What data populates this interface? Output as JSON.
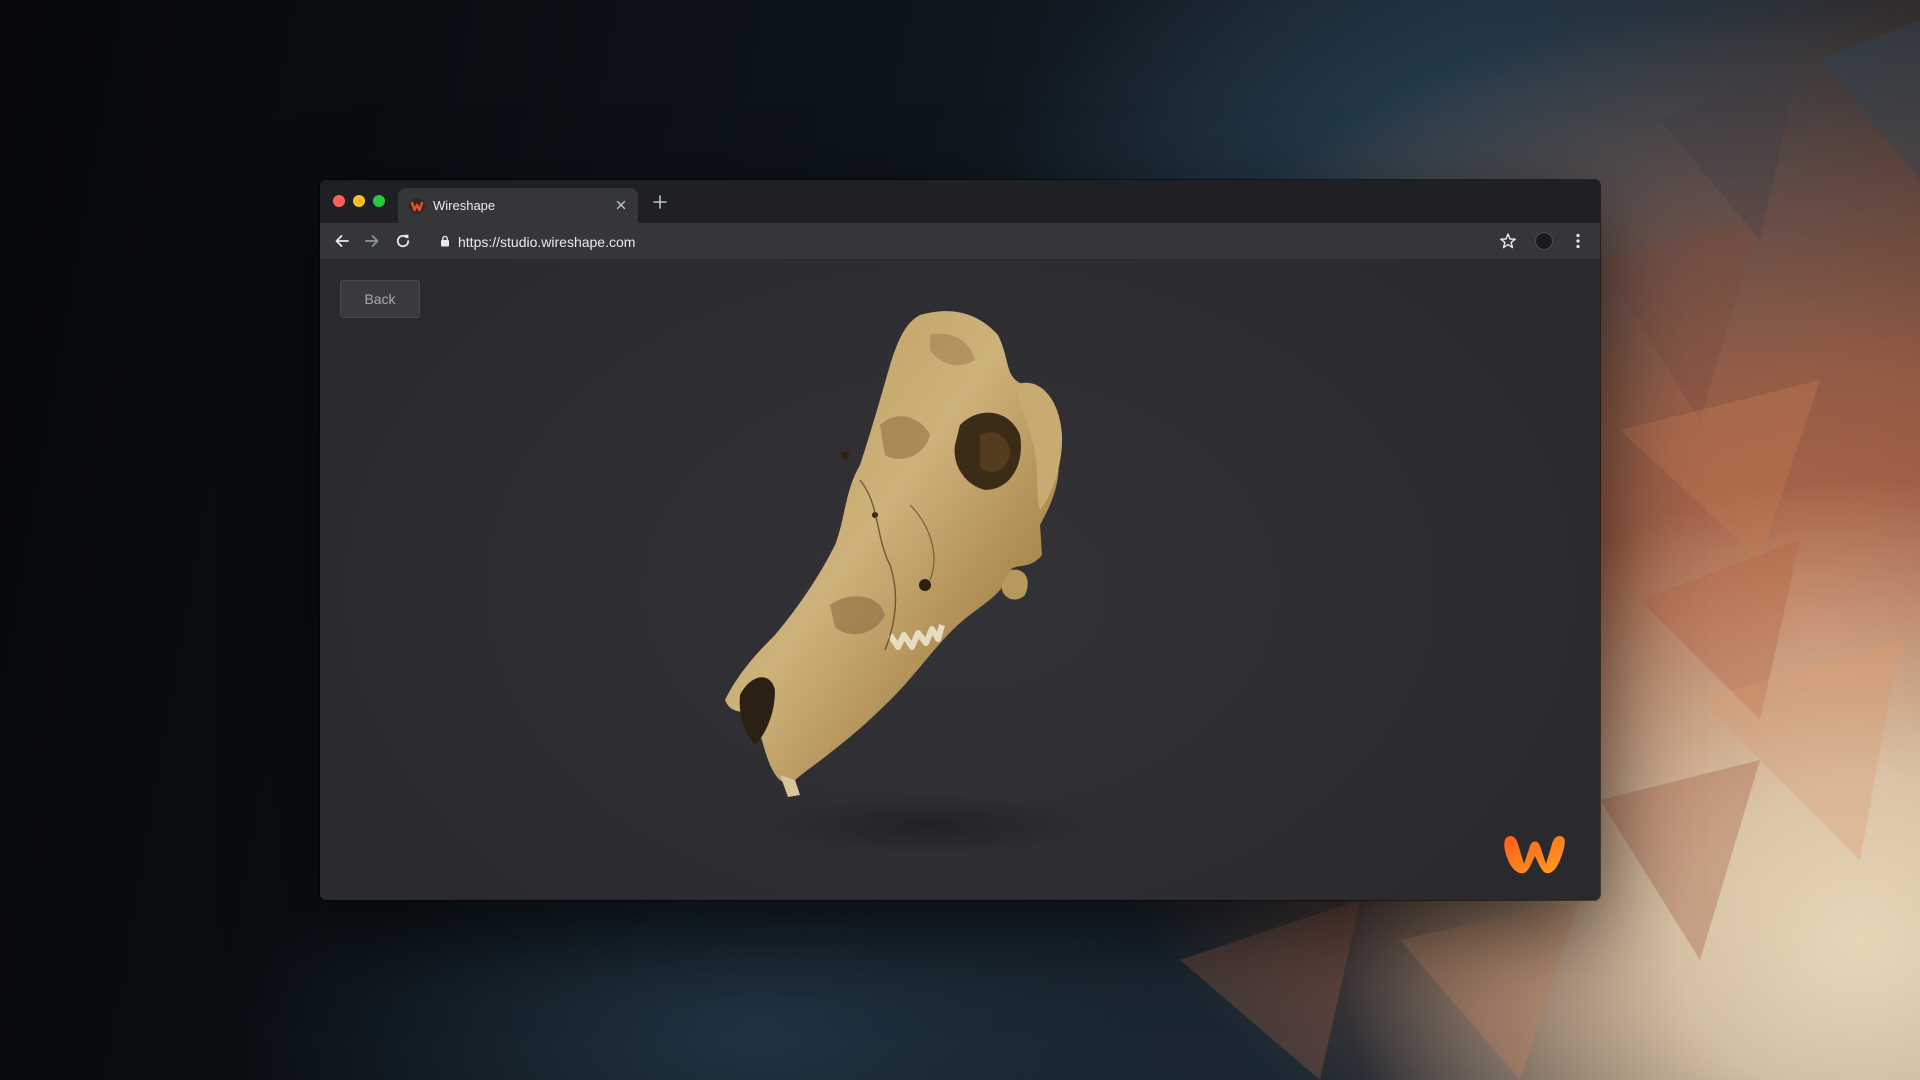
{
  "browser": {
    "tab": {
      "title": "Wireshape"
    },
    "address_bar": {
      "url": "https://studio.wireshape.com"
    }
  },
  "page": {
    "back_label": "Back",
    "model_name": "animal-skull-3d-model"
  },
  "icons": {
    "favicon": "wireshape-favicon",
    "tab_close": "close-icon",
    "new_tab": "plus-icon",
    "back": "arrow-left-icon",
    "forward": "arrow-right-icon",
    "reload": "reload-icon",
    "lock": "lock-icon",
    "bookmark": "star-icon",
    "profile": "avatar",
    "menu": "kebab-menu-icon",
    "brand": "wireshape-logo"
  },
  "colors": {
    "brand_orange": "#f04e1f",
    "brand_yellow": "#ff9a1e",
    "window_bg": "#303033",
    "toolbar": "#35363a",
    "tabstrip": "#1f2023"
  }
}
